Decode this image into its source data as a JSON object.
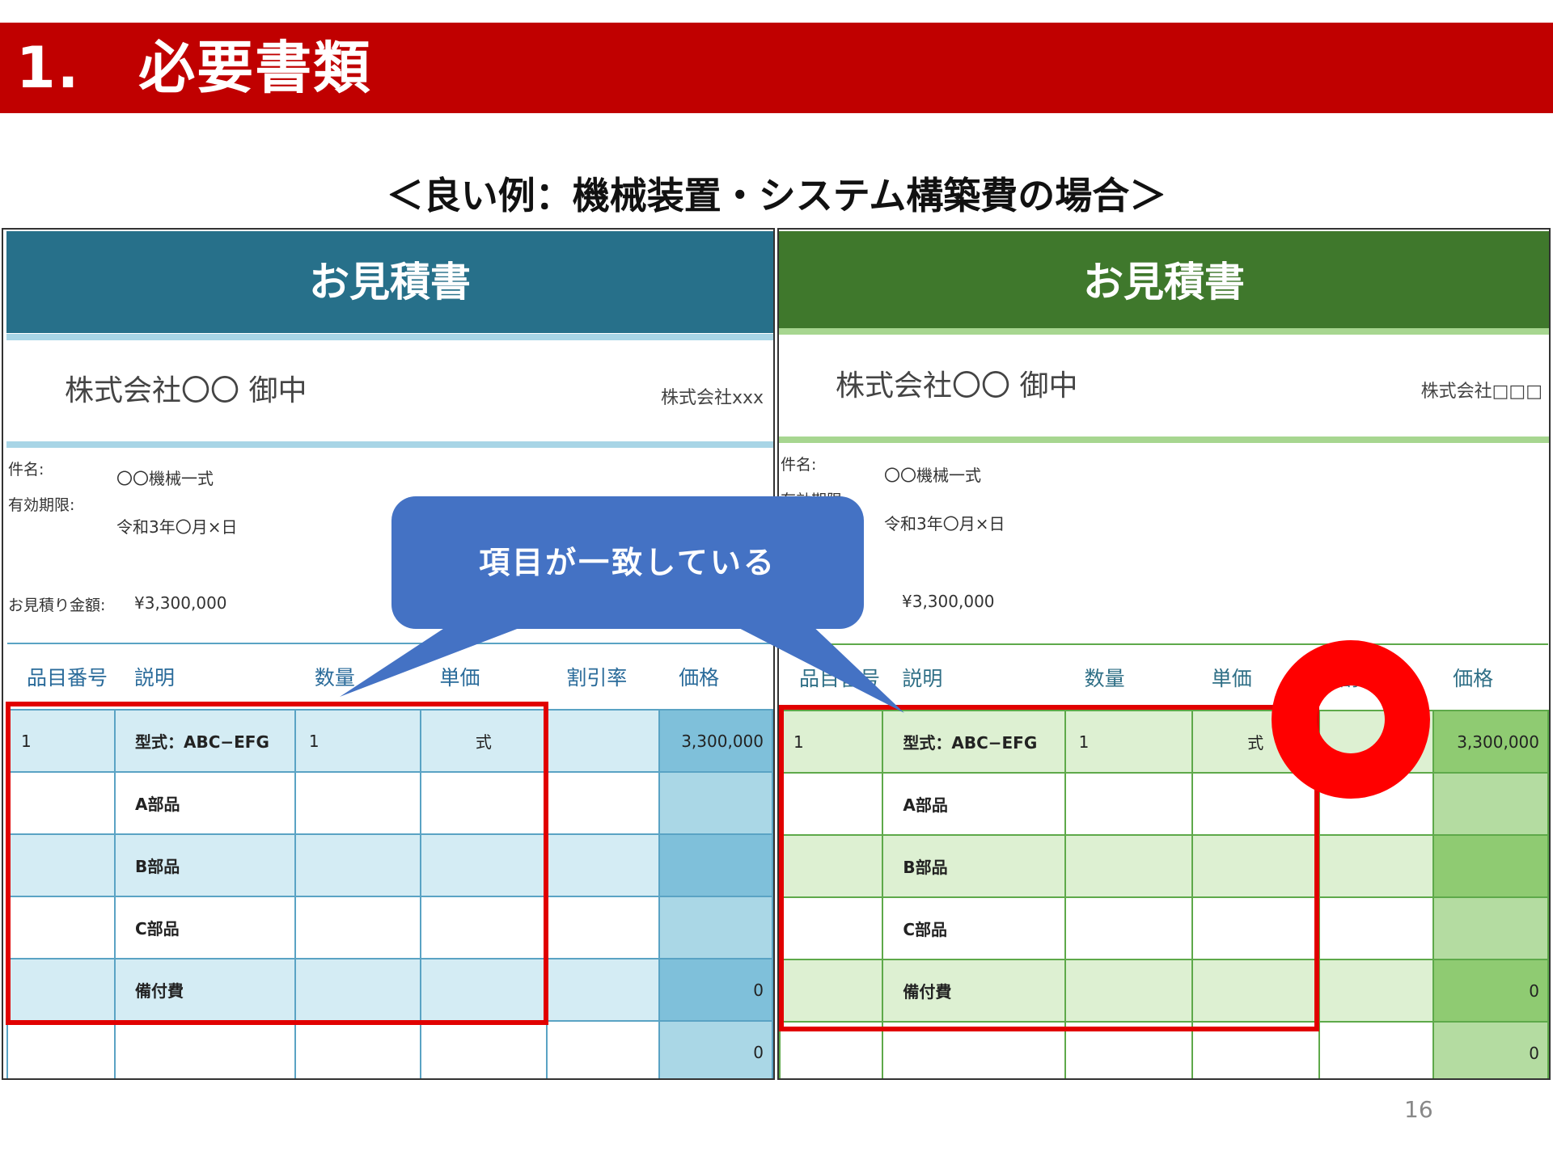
{
  "header": {
    "title": "1.　必要書類"
  },
  "subtitle": "＜良い例：機械装置・システム構築費の場合＞",
  "left_quote": {
    "title": "お見積書",
    "colors": {
      "banner": "#27708a",
      "stripe": "#a8d5e6",
      "header_text": "#2a6b9a",
      "row_shade": "#d4ecf4",
      "price_col": "#aad7e6",
      "price_col_dark": "#7fc0da",
      "grid": "#5aa3c4"
    },
    "to": "株式会社〇〇 御中",
    "from": "株式会社xxx",
    "subject_label": "件名:",
    "subject_value": "〇〇機械一式",
    "validity_label": "有効期限:",
    "validity_value": "令和3年〇月×日",
    "amount_label": "お見積り金額:",
    "amount_value": "¥3,300,000",
    "columns": [
      "品目番号",
      "説明",
      "数量",
      "単価",
      "割引率",
      "価格"
    ],
    "rows": [
      {
        "no": "1",
        "desc": "型式：ABC−EFG",
        "qty": "1",
        "unit": "式",
        "disc": "",
        "price": "3,300,000"
      },
      {
        "no": "",
        "desc": "A部品",
        "qty": "",
        "unit": "",
        "disc": "",
        "price": ""
      },
      {
        "no": "",
        "desc": "B部品",
        "qty": "",
        "unit": "",
        "disc": "",
        "price": ""
      },
      {
        "no": "",
        "desc": "C部品",
        "qty": "",
        "unit": "",
        "disc": "",
        "price": ""
      },
      {
        "no": "",
        "desc": "備付費",
        "qty": "",
        "unit": "",
        "disc": "",
        "price": "0"
      },
      {
        "no": "",
        "desc": "",
        "qty": "",
        "unit": "",
        "disc": "",
        "price": "0"
      }
    ]
  },
  "right_quote": {
    "title": "お見積書",
    "colors": {
      "banner": "#3f782c",
      "stripe": "#a7d690",
      "header_text": "#2f6f86",
      "row_shade": "#ddf0d2",
      "price_col": "#b4dca1",
      "price_col_dark": "#8fcb72",
      "grid": "#5ea94a"
    },
    "to": "株式会社〇〇 御中",
    "from": "株式会社□□□",
    "subject_label": "件名:",
    "subject_value": "〇〇機械一式",
    "validity_label": "有効期限:",
    "validity_value": "令和3年〇月×日",
    "amount_label": "",
    "amount_value": "¥3,300,000",
    "columns": [
      "品目番号",
      "説明",
      "数量",
      "単価",
      "割引率",
      "価格"
    ],
    "rows": [
      {
        "no": "1",
        "desc": "型式：ABC−EFG",
        "qty": "1",
        "unit": "式",
        "disc": "",
        "price": "3,300,000"
      },
      {
        "no": "",
        "desc": "A部品",
        "qty": "",
        "unit": "",
        "disc": "",
        "price": ""
      },
      {
        "no": "",
        "desc": "B部品",
        "qty": "",
        "unit": "",
        "disc": "",
        "price": ""
      },
      {
        "no": "",
        "desc": "C部品",
        "qty": "",
        "unit": "",
        "disc": "",
        "price": ""
      },
      {
        "no": "",
        "desc": "備付費",
        "qty": "",
        "unit": "",
        "disc": "",
        "price": "0"
      },
      {
        "no": "",
        "desc": "",
        "qty": "",
        "unit": "",
        "disc": "",
        "price": "0"
      }
    ]
  },
  "callout": {
    "text": "項目が一致している",
    "color": "#4472c4"
  },
  "highlight_color": "#e10000",
  "page_number": "16"
}
